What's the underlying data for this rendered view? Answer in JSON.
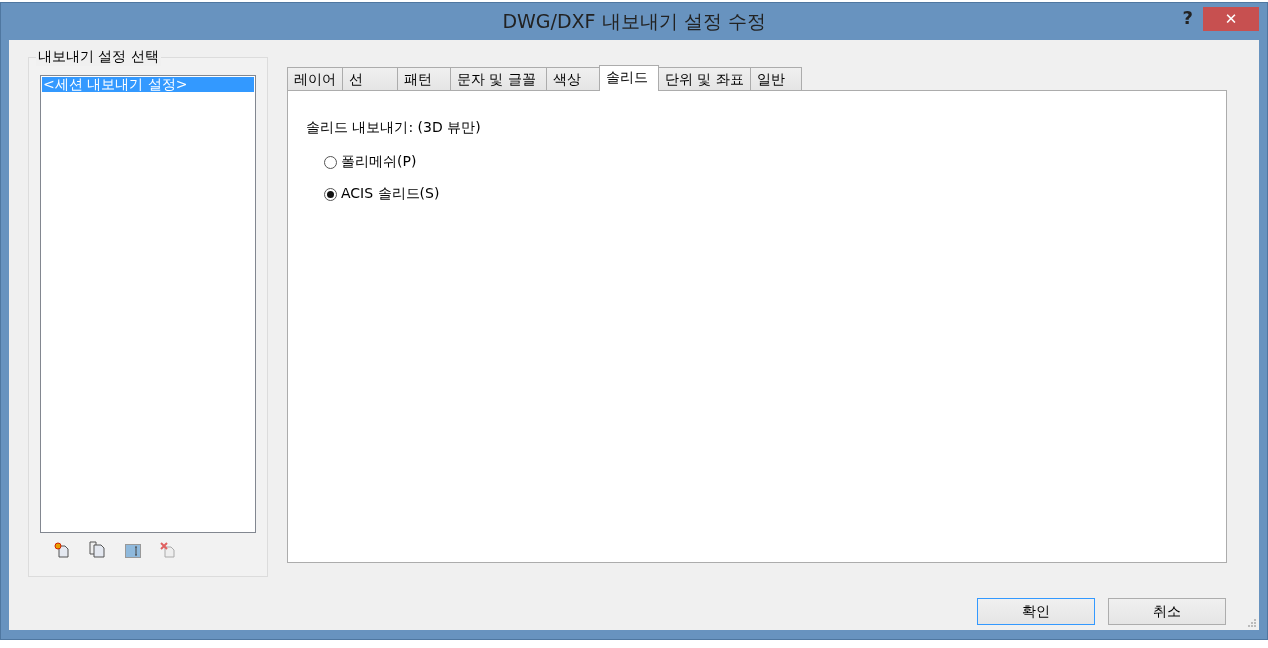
{
  "window": {
    "title": "DWG/DXF 내보내기 설정 수정",
    "help": "?",
    "close": "✕"
  },
  "setup_group": {
    "title": "내보내기 설정 선택",
    "items": [
      {
        "label": "<세션 내보내기 설정>",
        "selected": true
      }
    ]
  },
  "tabs": [
    {
      "label": "레이어",
      "selected": false
    },
    {
      "label": "선",
      "selected": false
    },
    {
      "label": "패턴",
      "selected": false
    },
    {
      "label": "문자 및 글꼴",
      "selected": false
    },
    {
      "label": "색상",
      "selected": false
    },
    {
      "label": "솔리드",
      "selected": true
    },
    {
      "label": "단위 및 좌표",
      "selected": false
    },
    {
      "label": "일반",
      "selected": false
    }
  ],
  "solids": {
    "label": "솔리드 내보내기: (3D 뷰만)",
    "options": [
      {
        "label": "폴리메쉬(P)",
        "selected": false
      },
      {
        "label": "ACIS 솔리드(S)",
        "selected": true
      }
    ]
  },
  "buttons": [
    {
      "label": "확인",
      "default": true
    },
    {
      "label": "취소",
      "default": false
    }
  ]
}
